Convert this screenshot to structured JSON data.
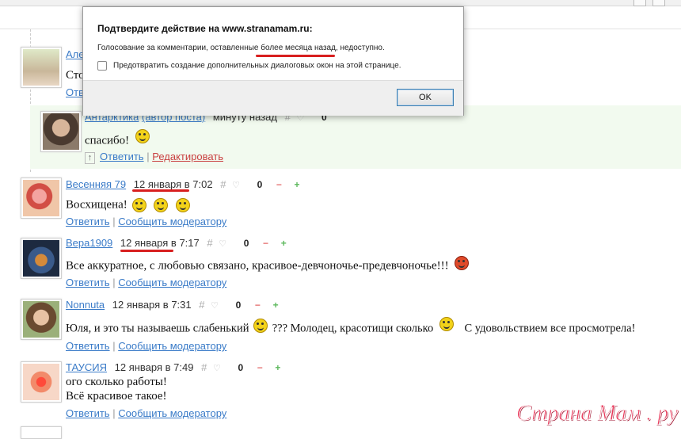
{
  "dialog": {
    "title": "Подтвердите действие на www.stranamam.ru:",
    "message_before": "Голосование за комментарии, оставленные ",
    "message_highlight": "более месяца назад",
    "message_after": ", недоступно.",
    "checkbox_label": "Предотвратить создание дополнительных диалоговых окон на этой странице.",
    "ok_label": "OK"
  },
  "partial_comment": {
    "author": "Але",
    "text": "Сто",
    "reply": "Отв"
  },
  "reply_comment": {
    "author": "Антарктика",
    "author_tag": "(автор поста)",
    "date": "минуту назад",
    "hash": "#",
    "score": "0",
    "text": "спасибо!",
    "up_arrow": "↑",
    "reply": "Ответить",
    "separator": "|",
    "edit": "Редактировать"
  },
  "comments": [
    {
      "author": "Весенняя 79",
      "date": "12 января в 7:02",
      "hash": "#",
      "score": "0",
      "text": "Восхищена!",
      "reply": "Ответить",
      "separator": "|",
      "report": "Сообщить модератору"
    },
    {
      "author": "Вера1909",
      "date": "12 января в 7:17",
      "hash": "#",
      "score": "0",
      "text": "Все аккуратное, с любовью связано, красивое-девчоночье-предевчоночье!!!",
      "reply": "Ответить",
      "separator": "|",
      "report": "Сообщить модератору"
    },
    {
      "author": "Nonnuta",
      "date": "12 января в 7:31",
      "hash": "#",
      "score": "0",
      "text_part1": "Юля, и это ты называешь слабенький",
      "text_part2": "??? Молодец, красотищи сколько",
      "text_part3": "С удовольствием все просмотрела!",
      "reply": "Ответить",
      "separator": "|",
      "report": "Сообщить модератору"
    },
    {
      "author": "ТАУСИЯ",
      "date": "12 января в 7:49",
      "hash": "#",
      "score": "0",
      "text_line1": "ого сколько работы!",
      "text_line2": "Всё красивое такое!",
      "reply": "Ответить",
      "separator": "|",
      "report": "Сообщить модератору"
    }
  ],
  "symbols": {
    "minus": "−",
    "plus": "+",
    "heart": "♡"
  },
  "watermark": "Страна Мам . ру",
  "colors": {
    "link": "#3a7bc8",
    "highlight_underline": "#d81f1f",
    "reply_background": "#f2faef",
    "watermark": "#e8385a"
  }
}
